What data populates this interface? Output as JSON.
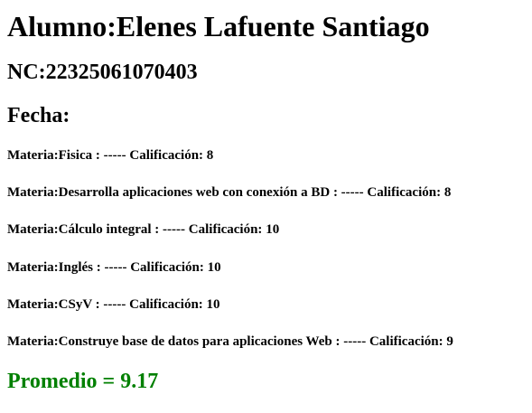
{
  "alumno": {
    "prefix": "Alumno:",
    "nombre": "Elenes Lafuente Santiago"
  },
  "nc": {
    "prefix": "NC:",
    "value": "22325061070403"
  },
  "fecha": {
    "label": "Fecha:"
  },
  "materias": [
    {
      "prefix": "Materia:",
      "nombre": "Fisica",
      "separator": " : ----- ",
      "calificacion_label": "Calificación: ",
      "calificacion": "8"
    },
    {
      "prefix": "Materia:",
      "nombre": "Desarrolla aplicaciones web con conexión a BD",
      "separator": " : ----- ",
      "calificacion_label": "Calificación: ",
      "calificacion": "8"
    },
    {
      "prefix": "Materia:",
      "nombre": "Cálculo integral",
      "separator": " : ----- ",
      "calificacion_label": "Calificación: ",
      "calificacion": "10"
    },
    {
      "prefix": "Materia:",
      "nombre": "Inglés",
      "separator": " : ----- ",
      "calificacion_label": "Calificación: ",
      "calificacion": "10"
    },
    {
      "prefix": "Materia:",
      "nombre": "CSyV",
      "separator": " : ----- ",
      "calificacion_label": "Calificación: ",
      "calificacion": "10"
    },
    {
      "prefix": "Materia:",
      "nombre": "Construye base de datos para aplicaciones Web",
      "separator": " : ----- ",
      "calificacion_label": "Calificación: ",
      "calificacion": "9"
    }
  ],
  "promedio": {
    "label": "Promedio = ",
    "value": "9.17",
    "color": "#008000"
  }
}
